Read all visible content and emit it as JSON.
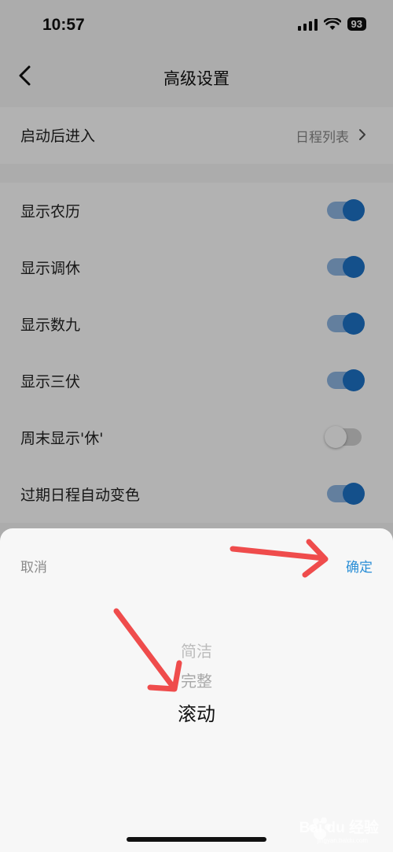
{
  "status_bar": {
    "time": "10:57",
    "battery": "93"
  },
  "nav": {
    "title": "高级设置"
  },
  "launch_row": {
    "label": "启动后进入",
    "value": "日程列表"
  },
  "toggles": [
    {
      "label": "显示农历",
      "on": true
    },
    {
      "label": "显示调休",
      "on": true
    },
    {
      "label": "显示数九",
      "on": true
    },
    {
      "label": "显示三伏",
      "on": true
    },
    {
      "label": "周末显示'休'",
      "on": false
    },
    {
      "label": "过期日程自动变色",
      "on": true
    }
  ],
  "sheet": {
    "cancel_label": "取消",
    "confirm_label": "确定",
    "options": [
      "简洁",
      "完整",
      "滚动"
    ],
    "selected": "滚动"
  },
  "watermark": {
    "text": "Bai du 经验",
    "url": "jingyan.baidu.com"
  },
  "colors": {
    "accent": "#1e73c8",
    "confirm": "#2a8ed6",
    "arrow": "#ef4c4c"
  }
}
